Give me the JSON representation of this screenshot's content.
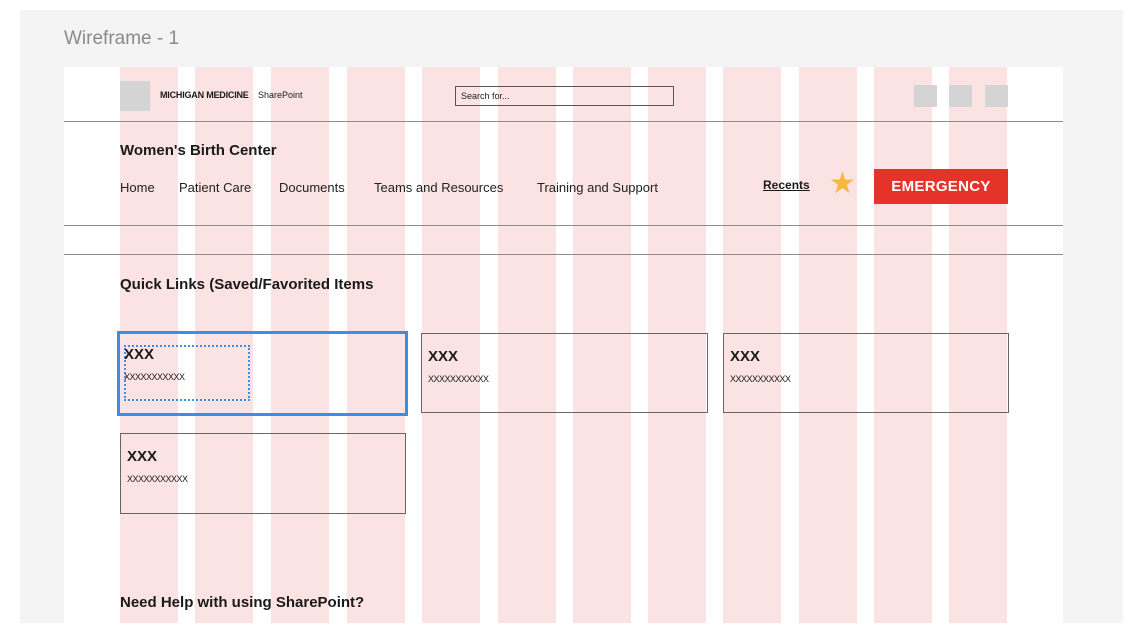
{
  "frame_title": "Wireframe - 1",
  "header": {
    "brand": "MICHIGAN MEDICINE",
    "app_name": "SharePoint",
    "search_placeholder": "Search for..."
  },
  "site": {
    "title": "Women's Birth Center",
    "nav": [
      "Home",
      "Patient Care",
      "Documents",
      "Teams and Resources",
      "Training and Support"
    ],
    "recents_label": "Recents",
    "emergency_label": "EMERGENCY"
  },
  "quick_links": {
    "title": "Quick Links (Saved/Favorited Items",
    "cards": [
      {
        "title": "XXX",
        "subtitle": "XXXXXXXXXXX"
      },
      {
        "title": "XXX",
        "subtitle": "XXXXXXXXXXX"
      },
      {
        "title": "XXX",
        "subtitle": "XXXXXXXXXXX"
      },
      {
        "title": "XXX",
        "subtitle": "XXXXXXXXXXX"
      }
    ]
  },
  "help": {
    "title": "Need Help with using SharePoint?"
  },
  "colors": {
    "grid_column": "#fbe3e3",
    "emergency": "#e63329",
    "star": "#f6b93b",
    "selection": "#3a8ee6"
  }
}
